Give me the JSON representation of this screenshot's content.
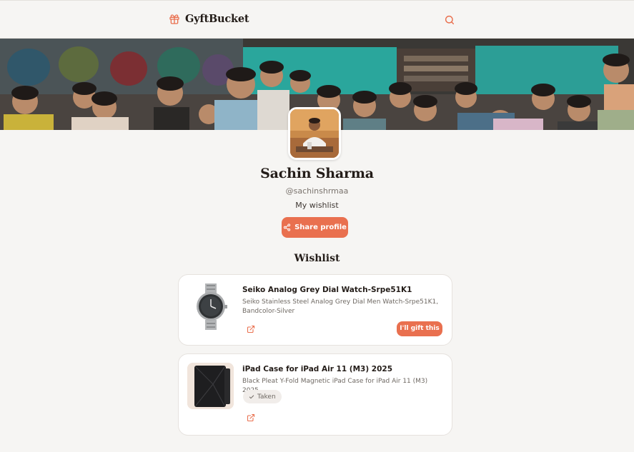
{
  "brand": {
    "name": "GyftBucket",
    "icon": "gift-icon"
  },
  "header": {
    "search_icon": "search-icon"
  },
  "colors": {
    "accent": "#e9704f",
    "background": "#f6f5f3",
    "card": "#ffffff",
    "text": "#231c18",
    "muted": "#7a736d"
  },
  "profile": {
    "name": "Sachin Sharma",
    "handle": "@sachinshrmaa",
    "bio": "My wishlist",
    "share_label": "Share profile"
  },
  "wishlist": {
    "title": "Wishlist",
    "items": [
      {
        "title": "Seiko Analog Grey Dial Watch-Srpe51K1",
        "description": "Seiko Stainless Steel Analog Grey Dial Men Watch-Srpe51K1, Bandcolor-Silver",
        "action_label": "I'll gift this",
        "link_icon": "external-link-icon"
      },
      {
        "title": "iPad Case for iPad Air 11 (M3) 2025",
        "description": "Black Pleat Y-Fold Magnetic iPad Case for iPad Air 11 (M3) 2025",
        "status_label": "Taken",
        "link_icon": "external-link-icon"
      }
    ]
  }
}
